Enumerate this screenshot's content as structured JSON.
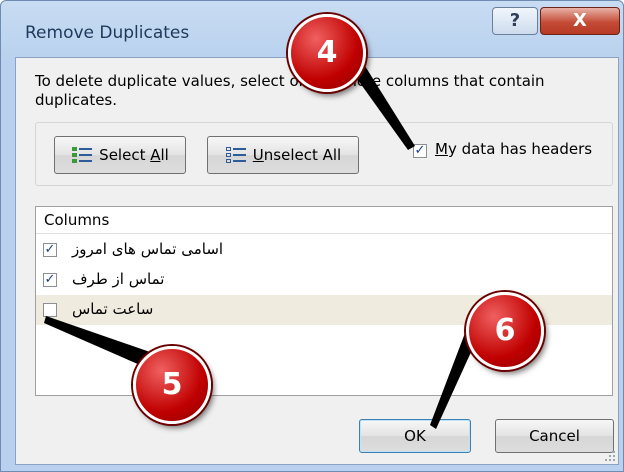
{
  "window": {
    "title": "Remove Duplicates",
    "help_glyph": "?",
    "close_glyph": "X"
  },
  "description": "To delete duplicate values, select one or more columns that contain duplicates.",
  "buttons": {
    "select_all_prefix": "Select ",
    "select_all_access": "A",
    "select_all_suffix": "ll",
    "unselect_all_access": "U",
    "unselect_all_suffix": "nselect All",
    "ok": "OK",
    "cancel": "Cancel"
  },
  "headers_checkbox": {
    "label_access": "M",
    "label_rest": "y data has headers",
    "checked": true
  },
  "columns": {
    "header": "Columns",
    "items": [
      {
        "label": "اسامی تماس های امروز",
        "checked": true
      },
      {
        "label": "تماس از طرف",
        "checked": true
      },
      {
        "label": "ساعت تماس",
        "checked": false
      }
    ]
  },
  "annotations": [
    "4",
    "5",
    "6"
  ],
  "colors": {
    "badge": "#c00000",
    "arrow": "#000000",
    "selected_row": "#efebde"
  }
}
